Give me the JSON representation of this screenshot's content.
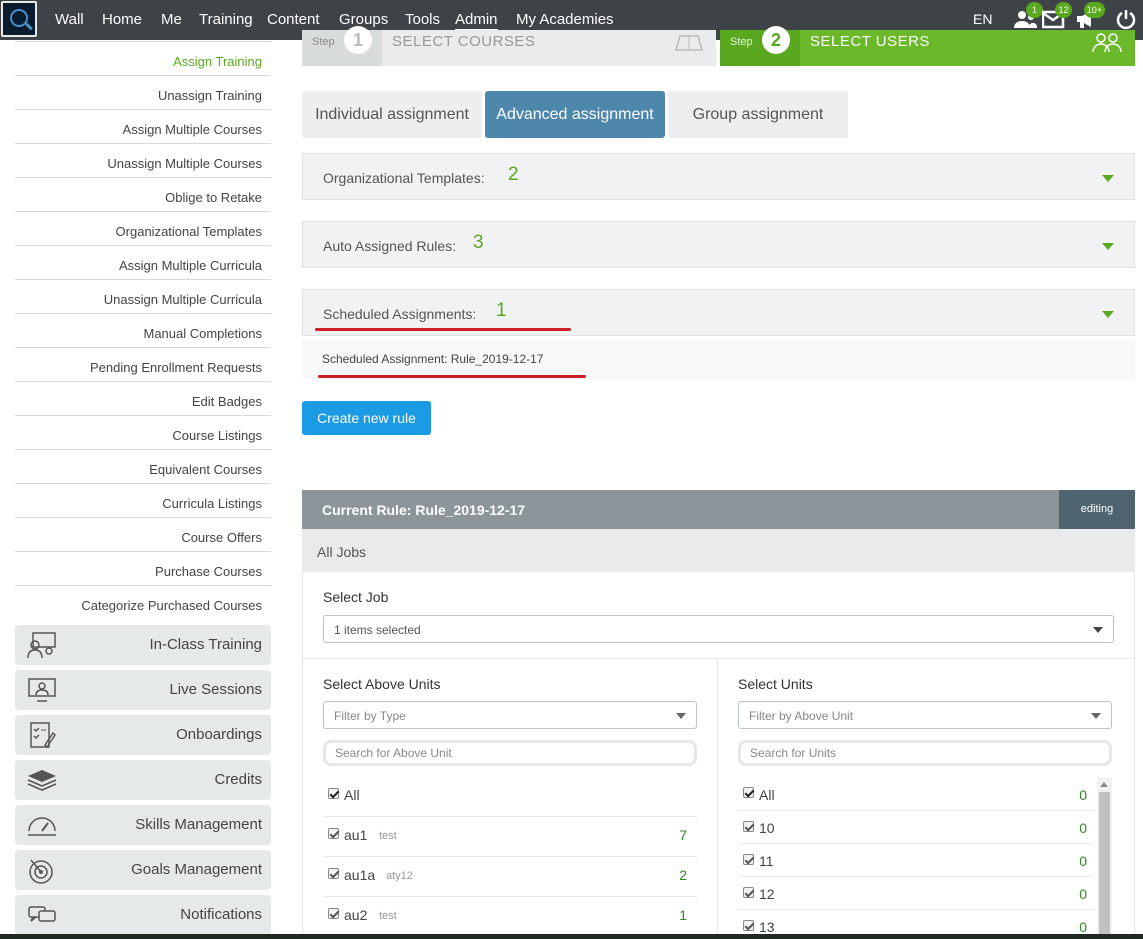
{
  "topbar": {
    "nav": [
      "Wall",
      "Home",
      "Me",
      "Training",
      "Content",
      "Groups",
      "Tools",
      "Admin",
      "My Academies"
    ],
    "active": "Admin",
    "language": "EN",
    "badges": {
      "users": "1",
      "messages": "12",
      "notifications": "10+"
    }
  },
  "sidebar": {
    "links": [
      "Assign Training",
      "Unassign Training",
      "Assign Multiple Courses",
      "Unassign Multiple Courses",
      "Oblige to Retake",
      "Organizational Templates",
      "Assign Multiple Curricula",
      "Unassign Multiple Curricula",
      "Manual Completions",
      "Pending Enrollment Requests",
      "Edit Badges",
      "Course Listings",
      "Equivalent Courses",
      "Curricula Listings",
      "Course Offers",
      "Purchase Courses",
      "Categorize Purchased Courses"
    ],
    "current": "Assign Training",
    "blocks": [
      {
        "label": "In-Class Training",
        "icon": "classroom-icon"
      },
      {
        "label": "Live Sessions",
        "icon": "live-session-icon"
      },
      {
        "label": "Onboardings",
        "icon": "onboarding-checklist-icon"
      },
      {
        "label": "Credits",
        "icon": "credits-stack-icon"
      },
      {
        "label": "Skills Management",
        "icon": "gauge-icon"
      },
      {
        "label": "Goals Management",
        "icon": "target-icon"
      },
      {
        "label": "Notifications",
        "icon": "chat-bubbles-icon"
      }
    ]
  },
  "steps": {
    "step1": {
      "small": "Step",
      "num": "1",
      "title": "SELECT COURSES"
    },
    "step2": {
      "small": "Step",
      "num": "2",
      "title": "SELECT USERS"
    }
  },
  "tabs": [
    {
      "label": "Individual assignment",
      "active": false
    },
    {
      "label": "Advanced assignment",
      "active": true
    },
    {
      "label": "Group assignment",
      "active": false
    }
  ],
  "accordions": [
    {
      "label": "Organizational Templates:",
      "count": "2"
    },
    {
      "label": "Auto Assigned Rules:",
      "count": "3"
    },
    {
      "label": "Scheduled Assignments:",
      "count": "1"
    }
  ],
  "scheduled_item": "Scheduled Assignment: Rule_2019-12-17",
  "create_button": "Create new rule",
  "rule": {
    "title": "Current Rule: Rule_2019-12-17",
    "status": "editing",
    "jobs_header": "All Jobs",
    "select_job_label": "Select Job",
    "select_job_value": "1 items selected",
    "above_units": {
      "label": "Select Above Units",
      "filter_placeholder": "Filter by Type",
      "search_placeholder": "Search for Above Unit",
      "all_label": "All",
      "rows": [
        {
          "name": "au1",
          "sub": "test",
          "count": "7"
        },
        {
          "name": "au1a",
          "sub": "aty12",
          "count": "2"
        },
        {
          "name": "au2",
          "sub": "test",
          "count": "1"
        }
      ]
    },
    "units": {
      "label": "Select Units",
      "filter_placeholder": "Filter by Above Unit",
      "search_placeholder": "Search for Units",
      "all_label": "All",
      "all_count": "0",
      "rows": [
        {
          "name": "10",
          "count": "0"
        },
        {
          "name": "11",
          "count": "0"
        },
        {
          "name": "12",
          "count": "0"
        },
        {
          "name": "13",
          "count": "0"
        }
      ]
    }
  },
  "colors": {
    "accent_green": "#5aa81f",
    "active_tab": "#4e87ac",
    "primary_button": "#1a9be3",
    "annotation_red": "#d01f24"
  }
}
